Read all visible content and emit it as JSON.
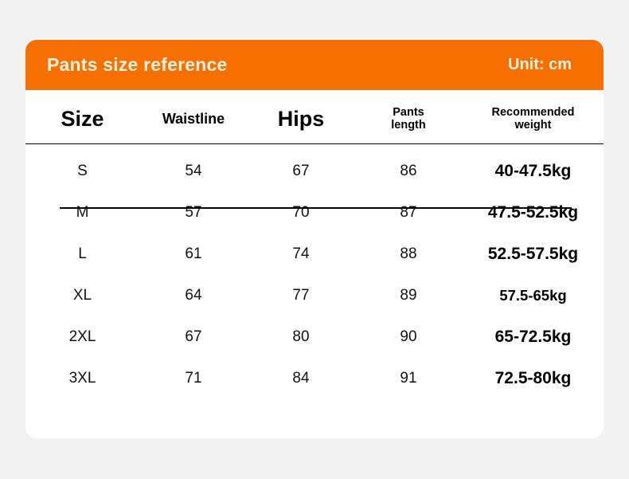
{
  "card": {
    "title": "Pants size reference",
    "unit": "Unit: cm",
    "header_bg": "#f57000",
    "header_text_color": "#fdf2e0",
    "card_bg": "#ffffff",
    "page_bg": "#f2f2f2"
  },
  "table": {
    "columns": [
      {
        "label": "Size",
        "emphasis": "xl"
      },
      {
        "label": "Waistline",
        "emphasis": "md"
      },
      {
        "label": "Hips",
        "emphasis": "xl"
      },
      {
        "label": "Pants length",
        "emphasis": "sm",
        "line1": "Pants",
        "line2": "length"
      },
      {
        "label": "Recommended weight",
        "emphasis": "sm",
        "line1": "Recommended",
        "line2": "weight"
      }
    ],
    "rows": [
      {
        "size": "S",
        "waistline": "54",
        "hips": "67",
        "pants_length": "86",
        "weight": "40-47.5kg"
      },
      {
        "size": "M",
        "waistline": "57",
        "hips": "70",
        "pants_length": "87",
        "weight": "47.5-52.5kg"
      },
      {
        "size": "L",
        "waistline": "61",
        "hips": "74",
        "pants_length": "88",
        "weight": "52.5-57.5kg"
      },
      {
        "size": "XL",
        "waistline": "64",
        "hips": "77",
        "pants_length": "89",
        "weight": "57.5-65kg"
      },
      {
        "size": "2XL",
        "waistline": "67",
        "hips": "80",
        "pants_length": "90",
        "weight": "65-72.5kg"
      },
      {
        "size": "3XL",
        "waistline": "71",
        "hips": "84",
        "pants_length": "91",
        "weight": "72.5-80kg"
      }
    ]
  }
}
